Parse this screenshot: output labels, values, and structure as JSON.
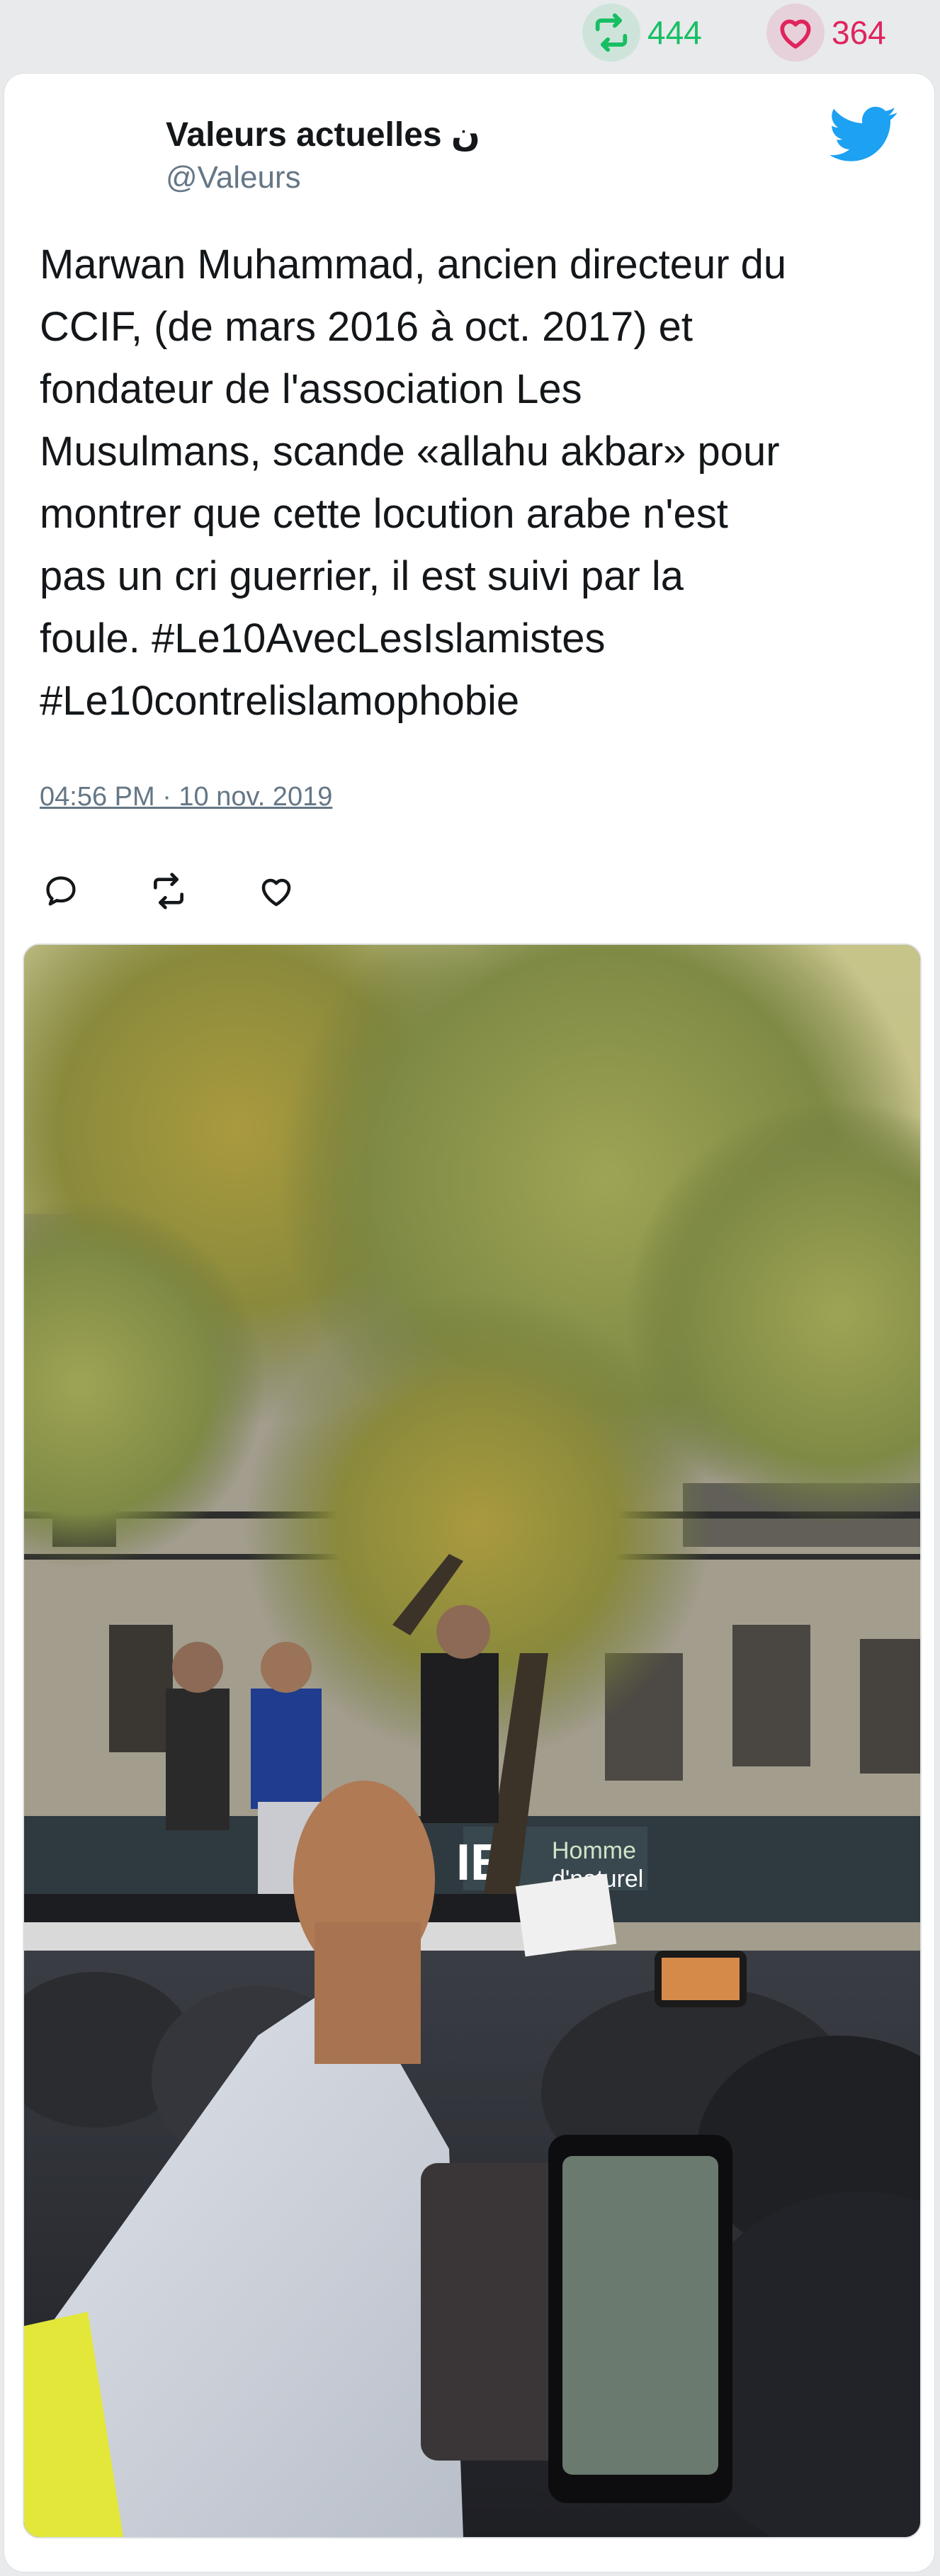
{
  "stats": {
    "retweets": "444",
    "likes": "364"
  },
  "tweet": {
    "author_name": "Valeurs actuelles ن",
    "author_handle": "@Valeurs",
    "text": "Marwan Muhammad, ancien directeur du\nCCIF, (de mars 2016 à oct. 2017) et\nfondateur de l'association Les\nMusulmans, scande «allahu akbar» pour\nmontrer que cette locution arabe n'est\npas un cri guerrier, il est suivi par la\nfoule. #Le10AvecLesIslamistes\n#Le10contrelislamophobie",
    "timestamp": "04:56 PM · 10 nov. 2019"
  },
  "media": {
    "sign_text_1": "IE",
    "sign_text_2": "Homme",
    "sign_text_3": "d'naturel"
  },
  "colors": {
    "retweet_green": "#17bf63",
    "like_red": "#e0245e",
    "twitter_blue": "#1da1f2",
    "text_dark": "#14171a",
    "text_muted": "#657786"
  },
  "icons": {
    "retweet_stat": "retweet-icon",
    "like_stat": "heart-icon",
    "brand": "twitter-bird-icon",
    "reply_action": "reply-icon",
    "retweet_action": "retweet-icon",
    "like_action": "heart-icon"
  }
}
